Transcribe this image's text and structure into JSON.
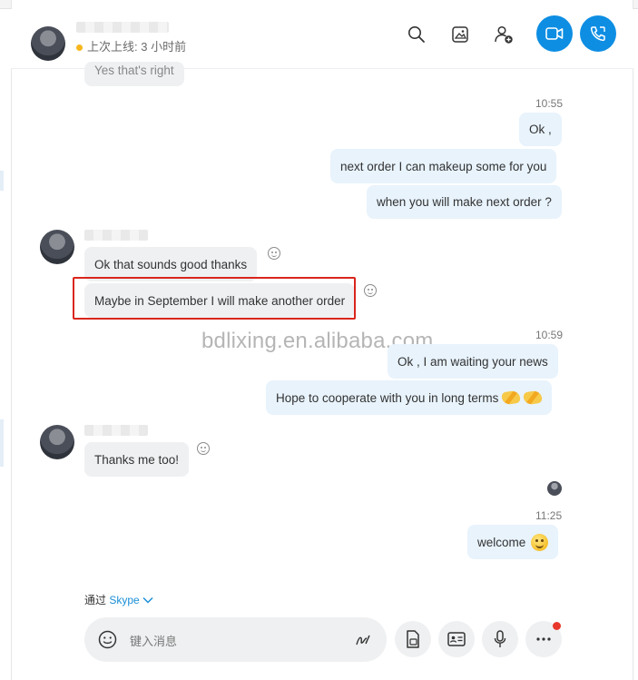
{
  "header": {
    "status_text": "上次上线: 3 小时前",
    "icons": [
      "search-icon",
      "image-gallery-icon",
      "add-person-icon",
      "video-call-icon",
      "audio-call-icon"
    ]
  },
  "messages": {
    "top_partial": "Yes that's right",
    "time_1": "10:55",
    "out_1": "Ok ,",
    "out_2": "next order I can makeup some for you",
    "out_3": "when you will make next order ?",
    "in_1": "Ok that sounds good thanks",
    "in_2": "Maybe in September I will make another order",
    "time_2": "10:59",
    "out_4": "Ok , I am waiting your news",
    "out_5": "Hope to cooperate with you in long terms",
    "in_3": "Thanks me too!",
    "time_3": "11:25",
    "out_6": "welcome"
  },
  "watermark": "bdlixing.en.alibaba.com",
  "footer": {
    "via_prefix": "通过",
    "via_app": "Skype",
    "composer_placeholder": "键入消息"
  },
  "colors": {
    "accent": "#0d8ee3",
    "outgoing_bubble": "#e8f3fc",
    "incoming_bubble": "#eef0f2",
    "highlight_box": "#d9261c",
    "status_away": "#f8b61c"
  }
}
